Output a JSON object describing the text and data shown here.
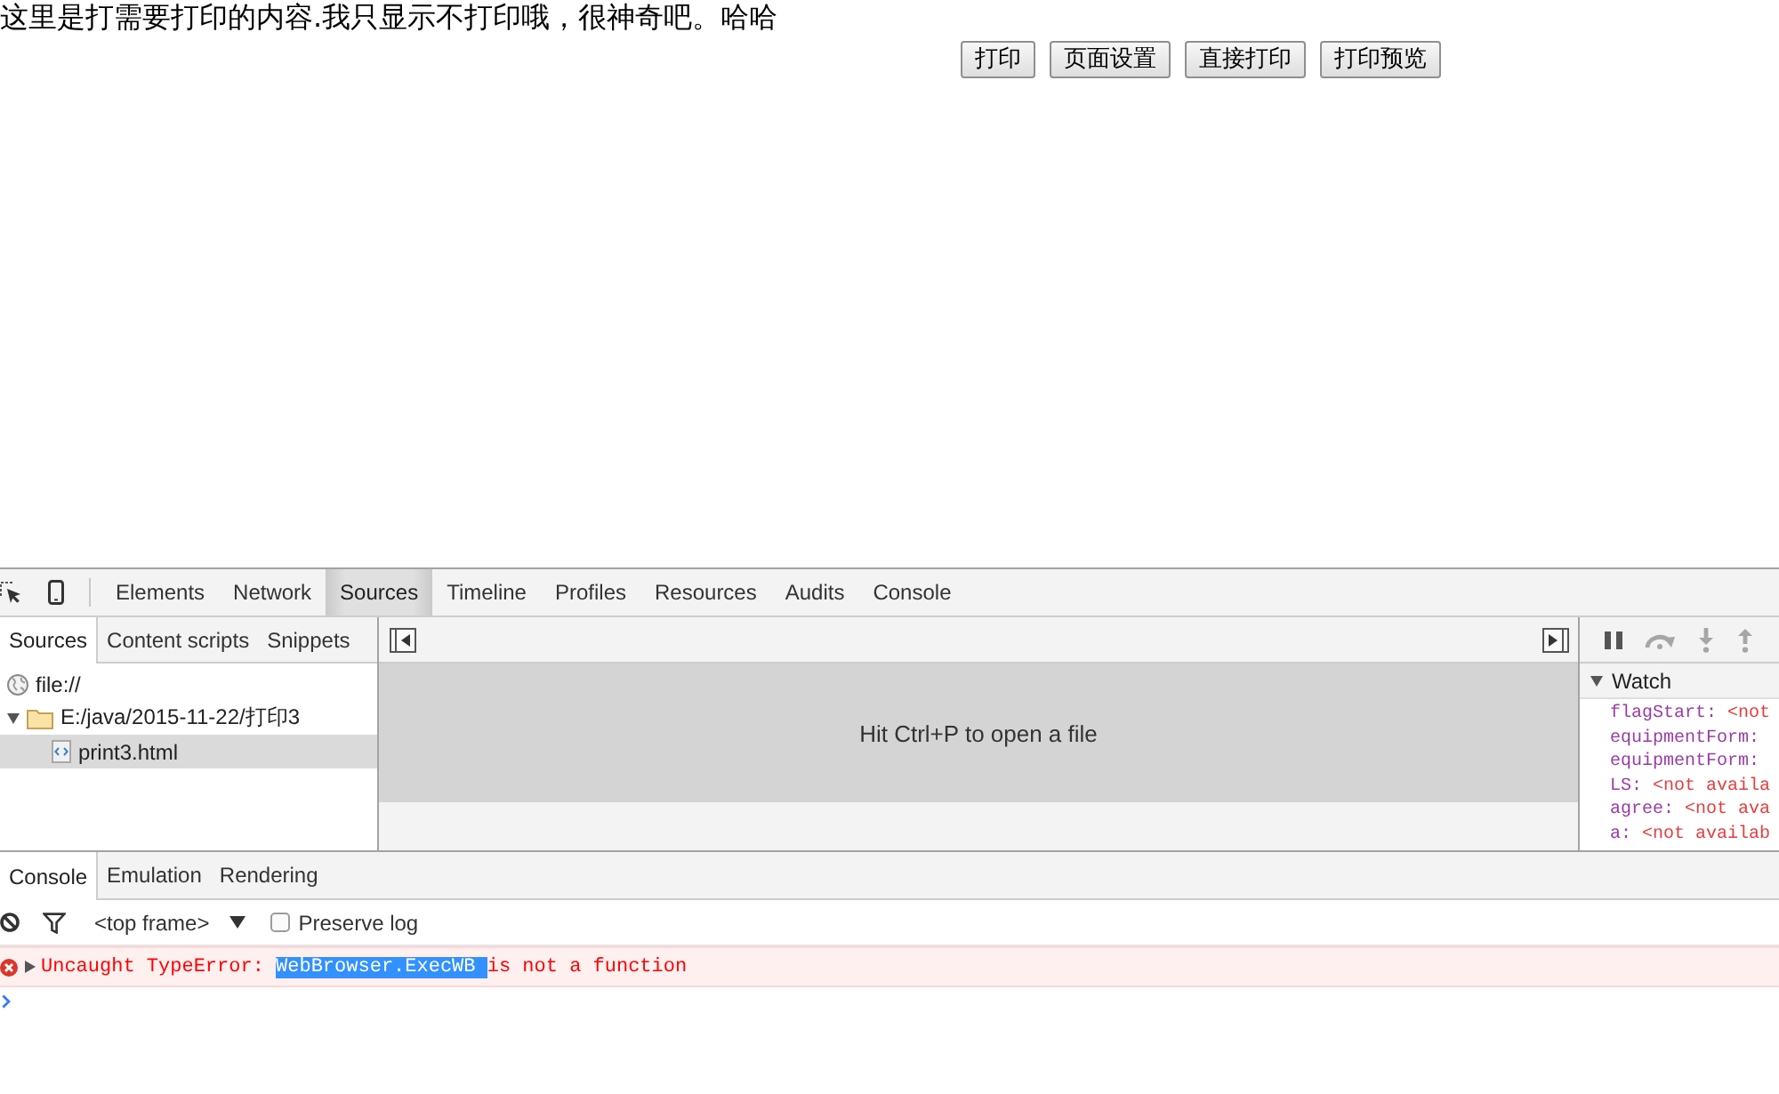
{
  "page": {
    "text": "这里是打需要打印的内容.我只显示不打印哦，很神奇吧。哈哈",
    "buttons": [
      "打印",
      "页面设置",
      "直接打印",
      "打印预览"
    ]
  },
  "devtools_tabs": [
    {
      "label": "Elements",
      "selected": false
    },
    {
      "label": "Network",
      "selected": false
    },
    {
      "label": "Sources",
      "selected": true
    },
    {
      "label": "Timeline",
      "selected": false
    },
    {
      "label": "Profiles",
      "selected": false
    },
    {
      "label": "Resources",
      "selected": false
    },
    {
      "label": "Audits",
      "selected": false
    },
    {
      "label": "Console",
      "selected": false
    }
  ],
  "navigator": {
    "tabs": [
      {
        "label": "Sources",
        "selected": true
      },
      {
        "label": "Content scripts",
        "selected": false
      },
      {
        "label": "Snippets",
        "selected": false
      }
    ],
    "tree": [
      {
        "label": "file://",
        "kind": "origin",
        "selected": false
      },
      {
        "label": "E:/java/2015-11-22/打印3",
        "kind": "folder",
        "expanded": true,
        "selected": false,
        "children": [
          {
            "label": "print3.html",
            "kind": "file",
            "selected": true
          }
        ]
      }
    ]
  },
  "editor": {
    "hint": "Hit Ctrl+P to open a file"
  },
  "debugger": {
    "controls": [
      {
        "kind": "pause",
        "disabled": false
      },
      {
        "kind": "step_over",
        "disabled": true
      },
      {
        "kind": "step_into",
        "disabled": true
      },
      {
        "kind": "step_out",
        "disabled": true
      }
    ],
    "watch": {
      "title": "Watch",
      "expanded": true,
      "entries": [
        {
          "name": "flagStart:",
          "value": "<not"
        },
        {
          "name": "equipmentForm:"
        },
        {
          "name": "equipmentForm:"
        },
        {
          "name": "LS:",
          "value": "<not availa"
        },
        {
          "name": "agree:",
          "value": "<not ava"
        },
        {
          "name": "a:",
          "value": "<not availab"
        }
      ]
    }
  },
  "drawer": {
    "tabs": [
      {
        "label": "Console",
        "selected": true
      },
      {
        "label": "Emulation",
        "selected": false
      },
      {
        "label": "Rendering",
        "selected": false
      }
    ],
    "context": "<top frame>",
    "preserve_log": {
      "label": "Preserve log",
      "checked": false
    },
    "messages": [
      {
        "kind": "error",
        "expanded": false,
        "parts": [
          {
            "text": "Uncaught TypeError:",
            "selected": false
          },
          {
            "text": "WebBrowser.ExecWB",
            "selected": true
          },
          {
            "text": "is not a function",
            "selected": false
          }
        ]
      }
    ]
  }
}
